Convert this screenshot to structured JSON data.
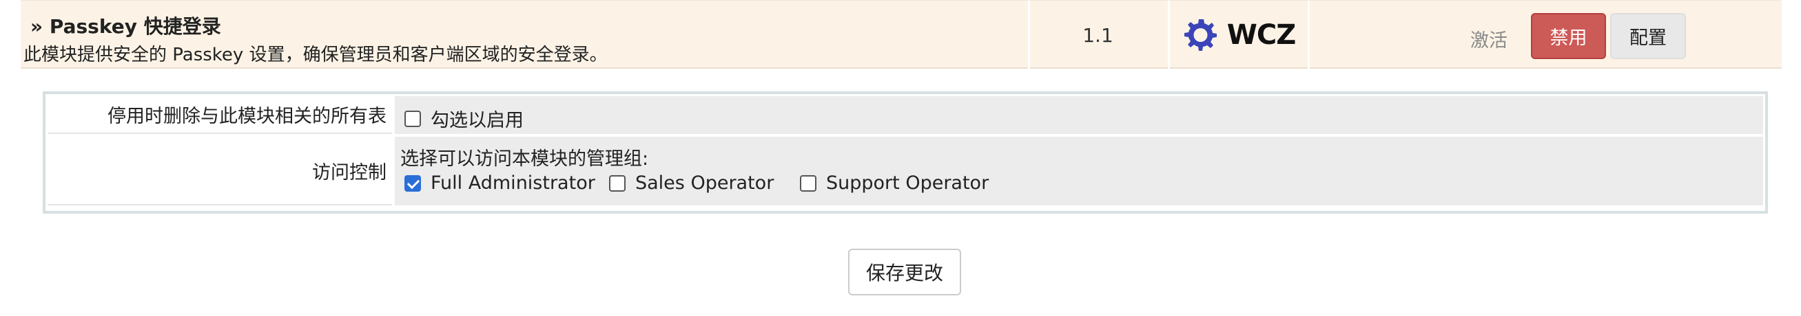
{
  "module": {
    "title": "» Passkey 快捷登录",
    "description": "此模块提供安全的 Passkey 设置，确保管理员和客户端区域的安全登录。",
    "version": "1.1",
    "vendor_logo_text": "WCZ",
    "vendor_logo_icon": "gear-logo-icon",
    "status_label": "激活",
    "disable_label": "禁用",
    "configure_label": "配置"
  },
  "settings": {
    "delete_tables": {
      "label": "停用时删除与此模块相关的所有表",
      "checkbox_label": "勾选以启用",
      "checked": false
    },
    "access_control": {
      "label": "访问控制",
      "prompt": "选择可以访问本模块的管理组:",
      "groups": [
        {
          "name": "Full Administrator",
          "checked": true
        },
        {
          "name": "Sales Operator",
          "checked": false
        },
        {
          "name": "Support Operator",
          "checked": false
        }
      ]
    }
  },
  "save_label": "保存更改",
  "colors": {
    "module_row_bg": "#fcf3e6",
    "disable_button": "#cc5a57",
    "logo_accent": "#3b44b8",
    "checkbox_checked": "#2a6ed8"
  }
}
